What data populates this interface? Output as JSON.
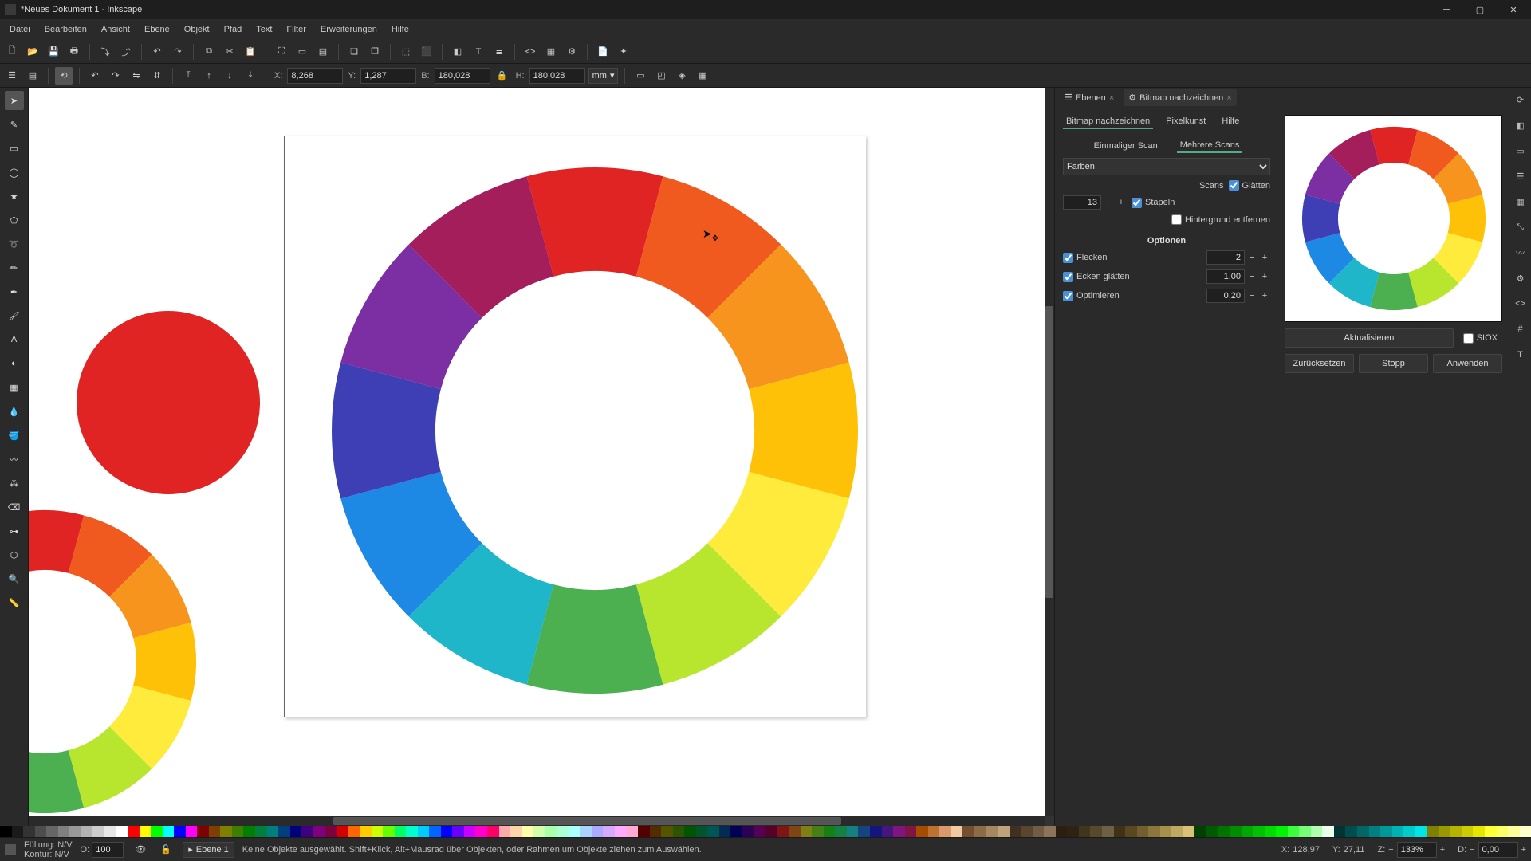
{
  "title": "*Neues Dokument 1 - Inkscape",
  "menu": [
    "Datei",
    "Bearbeiten",
    "Ansicht",
    "Ebene",
    "Objekt",
    "Pfad",
    "Text",
    "Filter",
    "Erweiterungen",
    "Hilfe"
  ],
  "controls": {
    "x_label": "X:",
    "x": "8,268",
    "y_label": "Y:",
    "y": "1,287",
    "w_label": "B:",
    "w": "180,028",
    "h_label": "H:",
    "h": "180,028",
    "unit": "mm"
  },
  "panel_tabs": {
    "layers": "Ebenen",
    "trace": "Bitmap nachzeichnen"
  },
  "trace": {
    "subtabs": {
      "main": "Bitmap nachzeichnen",
      "pixel": "Pixelkunst",
      "help": "Hilfe"
    },
    "scan_tabs": {
      "single": "Einmaliger Scan",
      "multi": "Mehrere Scans"
    },
    "mode": "Farben",
    "scans_label": "Scans",
    "scans": "13",
    "smooth": "Glätten",
    "stack": "Stapeln",
    "removebg": "Hintergrund entfernen",
    "options_title": "Optionen",
    "speckles": "Flecken",
    "speckles_val": "2",
    "smooth_corners": "Ecken glätten",
    "smooth_corners_val": "1,00",
    "optimize": "Optimieren",
    "optimize_val": "0,20",
    "update": "Aktualisieren",
    "siox": "SIOX",
    "reset": "Zurücksetzen",
    "stop": "Stopp",
    "apply": "Anwenden"
  },
  "status": {
    "fill_label": "Füllung:",
    "fill_val": "N/V",
    "stroke_label": "Kontur:",
    "stroke_val": "N/V",
    "opacity_label": "O:",
    "opacity": "100",
    "layer": "Ebene 1",
    "message": "Keine Objekte ausgewählt. Shift+Klick, Alt+Mausrad über Objekten, oder Rahmen um Objekte ziehen zum Auswählen.",
    "xcoord_label": "X:",
    "xcoord": "128,97",
    "ycoord_label": "Y:",
    "ycoord": "27,11",
    "zoom_label": "Z:",
    "zoom": "133%",
    "rotate_label": "D:",
    "rotate": "0,00"
  },
  "wheel_colors": [
    "#e53935",
    "#f4511e",
    "#fb8c00",
    "#ffb300",
    "#fdd835",
    "#ffeb3b",
    "#cddc39",
    "#8bc34a",
    "#4caf50",
    "#26a69a",
    "#29b6f6",
    "#1e88e5",
    "#3949ab",
    "#5e35b1",
    "#8e24aa",
    "#ad1457"
  ],
  "wheel12": [
    "#e02424",
    "#f05a1e",
    "#f7941e",
    "#ffc107",
    "#ffeb3b",
    "#b8e62e",
    "#4caf50",
    "#1eb6c8",
    "#1e88e5",
    "#3f3fb5",
    "#7b2fa3",
    "#a31e5a"
  ],
  "red_circle": "#e02424",
  "palette": [
    "#000000",
    "#1a1a1a",
    "#333333",
    "#4d4d4d",
    "#666666",
    "#808080",
    "#999999",
    "#b3b3b3",
    "#cccccc",
    "#e6e6e6",
    "#ffffff",
    "#ff0000",
    "#ffff00",
    "#00ff00",
    "#00ffff",
    "#0000ff",
    "#ff00ff",
    "#7f0000",
    "#7f3f00",
    "#7f7f00",
    "#3f7f00",
    "#007f00",
    "#007f3f",
    "#007f7f",
    "#003f7f",
    "#00007f",
    "#3f007f",
    "#7f007f",
    "#7f003f",
    "#d40000",
    "#ff6600",
    "#ffcc00",
    "#ccff00",
    "#66ff00",
    "#00ff66",
    "#00ffcc",
    "#00ccff",
    "#0066ff",
    "#0000ff",
    "#6600ff",
    "#cc00ff",
    "#ff00cc",
    "#ff0066",
    "#ffaaaa",
    "#ffd4aa",
    "#ffffaa",
    "#d4ffaa",
    "#aaffaa",
    "#aaffd4",
    "#aaffff",
    "#aad4ff",
    "#aaaaff",
    "#d4aaff",
    "#ffaaff",
    "#ffaad4",
    "#550000",
    "#552b00",
    "#555500",
    "#2b5500",
    "#005500",
    "#00552b",
    "#005555",
    "#002b55",
    "#000055",
    "#2b0055",
    "#550055",
    "#55002b",
    "#801515",
    "#804515",
    "#808015",
    "#458015",
    "#158015",
    "#158045",
    "#158080",
    "#154580",
    "#151580",
    "#451580",
    "#801580",
    "#801545",
    "#a64b00",
    "#bf7130",
    "#d99a6c",
    "#f2c9a0",
    "#734f30",
    "#8c6b46",
    "#a68760",
    "#bfa37d",
    "#403020",
    "#594530",
    "#735c44",
    "#8c735a",
    "#2d1e0f",
    "#2d2310",
    "#40351d",
    "#59492c",
    "#6e6046",
    "#403214",
    "#594720",
    "#735e2d",
    "#8c763c",
    "#a6904e",
    "#bfa961",
    "#d9c276",
    "#004000",
    "#005a00",
    "#007400",
    "#008e00",
    "#00a800",
    "#00c200",
    "#00dc00",
    "#00f600",
    "#3cff3c",
    "#76ff76",
    "#b0ffb0",
    "#eaffea",
    "#003333",
    "#004d4d",
    "#006666",
    "#008080",
    "#009999",
    "#00b3b3",
    "#00cccc",
    "#00e6e6",
    "#808000",
    "#999900",
    "#b3b300",
    "#cccc00",
    "#e6e600",
    "#ffff33",
    "#ffff66",
    "#ffff99",
    "#ffffcc"
  ]
}
